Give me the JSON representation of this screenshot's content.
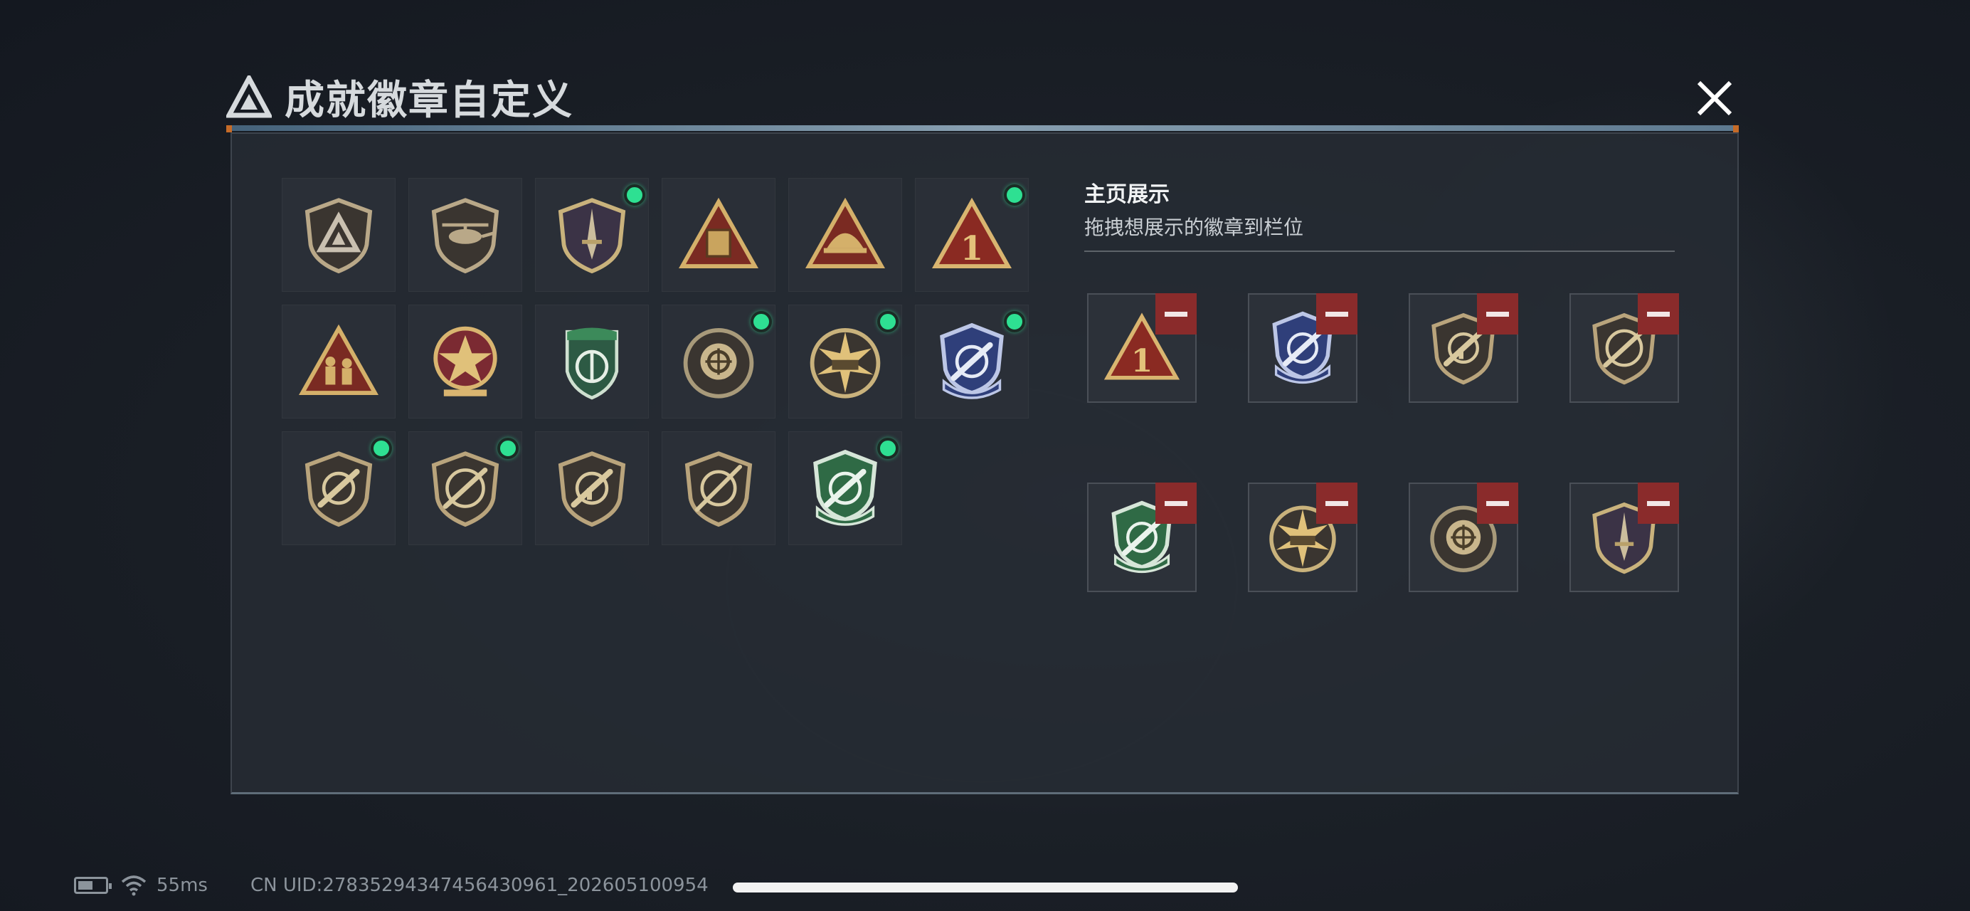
{
  "dialog": {
    "title": "成就徽章自定义"
  },
  "badges": [
    {
      "icon": "triangle-logo-shield-badge-icon",
      "new": false
    },
    {
      "icon": "helicopter-shield-badge-icon",
      "new": false
    },
    {
      "icon": "dagger-shield-badge-icon",
      "new": true
    },
    {
      "icon": "crate-triangle-badge-icon",
      "new": false
    },
    {
      "icon": "helmet-triangle-badge-icon",
      "new": false
    },
    {
      "icon": "number-one-triangle-badge-icon",
      "new": true,
      "label": "1"
    },
    {
      "icon": "soldiers-triangle-badge-icon",
      "new": false
    },
    {
      "icon": "star-medal-badge-icon",
      "new": false
    },
    {
      "icon": "green-emblem-badge-icon",
      "new": false
    },
    {
      "icon": "crosshair-skull-badge-icon",
      "new": true
    },
    {
      "icon": "tank-burst-badge-icon",
      "new": true
    },
    {
      "icon": "blue-rifle-crest-badge-icon",
      "new": true
    },
    {
      "icon": "rifle-shield-badge-icon",
      "new": true
    },
    {
      "icon": "shotgun-shield-badge-icon",
      "new": true
    },
    {
      "icon": "smg-shield-badge-icon",
      "new": false
    },
    {
      "icon": "sniper-shield-badge-icon",
      "new": false
    },
    {
      "icon": "green-rifle-crest-badge-icon",
      "new": true
    }
  ],
  "showcase": {
    "title": "主页展示",
    "subtitle": "拖拽想展示的徽章到栏位",
    "slots": [
      {
        "icon": "number-one-triangle-badge-icon",
        "label": "1"
      },
      {
        "icon": "blue-rifle-crest-badge-icon"
      },
      {
        "icon": "smg-shield-badge-icon"
      },
      {
        "icon": "shotgun-shield-badge-icon"
      },
      {
        "icon": "green-rifle-crest-badge-icon"
      },
      {
        "icon": "tank-burst-badge-icon"
      },
      {
        "icon": "crosshair-skull-badge-icon"
      },
      {
        "icon": "dagger-shield-badge-icon"
      }
    ]
  },
  "status": {
    "ping": "55ms",
    "uid": "CN UID:27835294347456430961_202605100954"
  },
  "colors": {
    "new_dot": "#2ee092",
    "remove": "#8a2b2b",
    "panel": "#262b33"
  }
}
